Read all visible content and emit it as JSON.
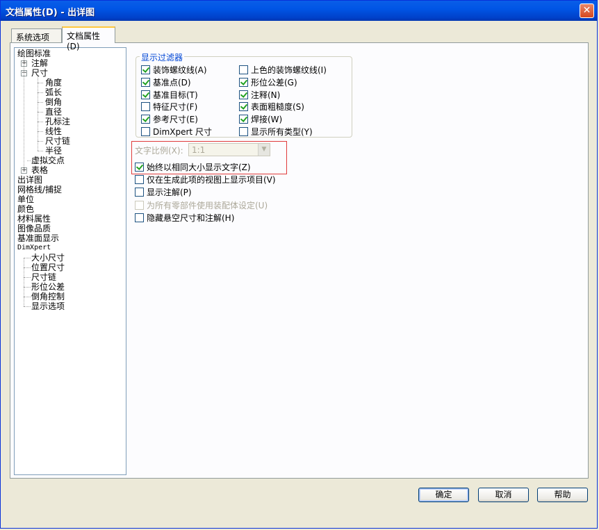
{
  "window": {
    "title": "文档属性(D) - 出详图"
  },
  "tabs": [
    {
      "label": "系统选项(S)"
    },
    {
      "label": "文档属性(D)"
    }
  ],
  "tree": {
    "items": [
      "绘图标准",
      "注解",
      "尺寸",
      "角度",
      "弧长",
      "倒角",
      "直径",
      "孔标注",
      "线性",
      "尺寸链",
      "半径",
      "虚拟交点",
      "表格",
      "出详图",
      "网格线/捕捉",
      "单位",
      "颜色",
      "材料属性",
      "图像品质",
      "基准面显示",
      "DimXpert",
      "大小尺寸",
      "位置尺寸",
      "尺寸链",
      "形位公差",
      "倒角控制",
      "显示选项"
    ]
  },
  "display_filter": {
    "title": "显示过滤器",
    "left": [
      {
        "label": "装饰螺纹线(A)",
        "checked": true
      },
      {
        "label": "基准点(D)",
        "checked": true
      },
      {
        "label": "基准目标(T)",
        "checked": true
      },
      {
        "label": "特征尺寸(F)",
        "checked": false
      },
      {
        "label": "参考尺寸(E)",
        "checked": true
      },
      {
        "label": "DimXpert 尺寸",
        "checked": false
      }
    ],
    "right": [
      {
        "label": "上色的装饰螺纹线(I)",
        "checked": false
      },
      {
        "label": "形位公差(G)",
        "checked": true
      },
      {
        "label": "注释(N)",
        "checked": true
      },
      {
        "label": "表面粗糙度(S)",
        "checked": true
      },
      {
        "label": "焊接(W)",
        "checked": true
      },
      {
        "label": "显示所有类型(Y)",
        "checked": false
      }
    ]
  },
  "text_scale": {
    "label": "文字比例(X):",
    "value": "1:1"
  },
  "options": [
    {
      "label": "始终以相同大小显示文字(Z)",
      "checked": true,
      "disabled": false
    },
    {
      "label": "仅在生成此项的视图上显示项目(V)",
      "checked": false,
      "disabled": false
    },
    {
      "label": "显示注解(P)",
      "checked": false,
      "disabled": false
    },
    {
      "label": "为所有零部件使用装配体设定(U)",
      "checked": false,
      "disabled": true
    },
    {
      "label": "隐藏悬空尺寸和注解(H)",
      "checked": false,
      "disabled": false
    }
  ],
  "buttons": {
    "ok": "确定",
    "cancel": "取消",
    "help": "帮助"
  },
  "colors": {
    "titlebar": "#0055e5",
    "highlight": "#e03b3b",
    "group_title": "#0046d5"
  }
}
